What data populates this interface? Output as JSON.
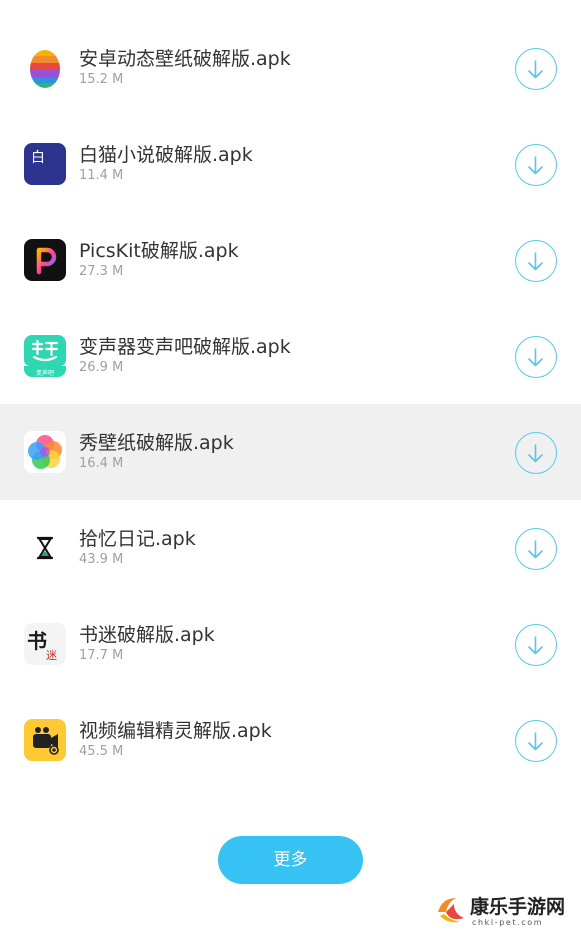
{
  "downloads": [
    {
      "name": "安卓动态壁纸破解版.apk",
      "size": "15.2 M",
      "icon": "rainbow-egg-icon"
    },
    {
      "name": "白猫小说破解版.apk",
      "size": "11.4 M",
      "icon": "baimao-novel-icon",
      "icon_text": "白猫"
    },
    {
      "name": "PicsKit破解版.apk",
      "size": "27.3 M",
      "icon": "picskit-icon"
    },
    {
      "name": "变声器变声吧破解版.apk",
      "size": "26.9 M",
      "icon": "voice-changer-icon",
      "icon_text": "变声吧"
    },
    {
      "name": "秀壁纸破解版.apk",
      "size": "16.4 M",
      "icon": "flower-petals-icon",
      "highlighted": true
    },
    {
      "name": "拾忆日记.apk",
      "size": "43.9 M",
      "icon": "hourglass-icon"
    },
    {
      "name": "书迷破解版.apk",
      "size": "17.7 M",
      "icon": "calligraphy-icon",
      "icon_text": "书迷"
    },
    {
      "name": "视频编辑精灵解版.apk",
      "size": "45.5 M",
      "icon": "video-camera-icon"
    }
  ],
  "more_button": {
    "label": "更多"
  },
  "watermark": {
    "title": "康乐手游网",
    "subtitle": "chkl-pet.com"
  },
  "colors": {
    "accent": "#36c2f2",
    "download_outline": "#57c6ec",
    "highlight_row": "#f0f0f0"
  }
}
